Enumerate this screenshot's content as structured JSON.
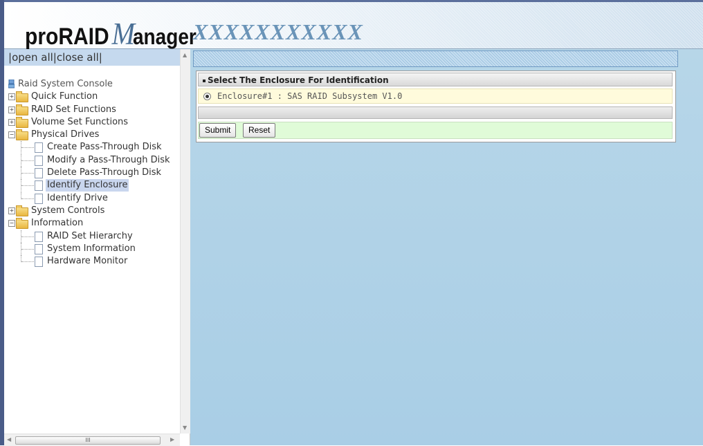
{
  "header": {
    "logo_pro": "proRAID",
    "logo_m": "M",
    "logo_rest": "anager",
    "model": "XXXXXXXXXXX"
  },
  "sidebar": {
    "open_all": "open all",
    "close_all": "close all",
    "root_label": "Raid System Console",
    "items": [
      {
        "label": "Quick Function",
        "kind": "folder",
        "state": "collapsed"
      },
      {
        "label": "RAID Set Functions",
        "kind": "folder",
        "state": "collapsed"
      },
      {
        "label": "Volume Set Functions",
        "kind": "folder",
        "state": "collapsed"
      },
      {
        "label": "Physical Drives",
        "kind": "folder",
        "state": "expanded"
      },
      {
        "label": "Create Pass-Through Disk",
        "kind": "page"
      },
      {
        "label": "Modify a Pass-Through Disk",
        "kind": "page"
      },
      {
        "label": "Delete Pass-Through Disk",
        "kind": "page"
      },
      {
        "label": "Identify Enclosure",
        "kind": "page",
        "selected": true
      },
      {
        "label": "Identify Drive",
        "kind": "page"
      },
      {
        "label": "System Controls",
        "kind": "folder",
        "state": "collapsed"
      },
      {
        "label": "Information",
        "kind": "folder",
        "state": "expanded"
      },
      {
        "label": "RAID Set Hierarchy",
        "kind": "page"
      },
      {
        "label": "System Information",
        "kind": "page"
      },
      {
        "label": "Hardware Monitor",
        "kind": "page"
      }
    ],
    "scroll_grip": "III"
  },
  "main": {
    "panel_title": "Select The Enclosure For Identification",
    "enclosure_option": "Enclosure#1 : SAS RAID Subsystem V1.0",
    "enclosure_selected": true,
    "submit_label": "Submit",
    "reset_label": "Reset"
  },
  "colors": {
    "content_bg": "#b0d2e7",
    "option_row_bg": "#fffbdc",
    "action_row_bg": "#e0fbd8",
    "selected_item_bg": "#c9d6ee"
  }
}
